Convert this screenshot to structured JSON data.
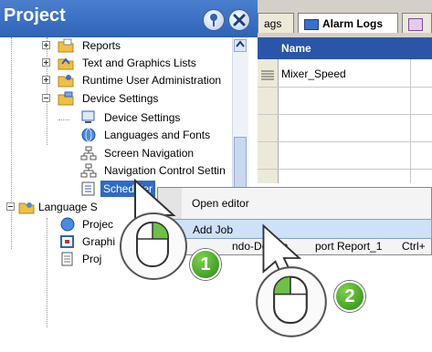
{
  "project_panel": {
    "title": "Project",
    "tree": [
      {
        "label": "Reports",
        "expander": "plus"
      },
      {
        "label": "Text and Graphics Lists",
        "expander": "plus"
      },
      {
        "label": "Runtime User Administration",
        "expander": "plus"
      },
      {
        "label": "Device Settings",
        "expander": "minus"
      },
      {
        "label": "Device Settings"
      },
      {
        "label": "Languages and Fonts"
      },
      {
        "label": "Screen Navigation"
      },
      {
        "label": "Navigation Control Settin"
      },
      {
        "label": "Scheduler",
        "selected": true
      },
      {
        "label": "Language Settings",
        "visible_label": "Language S",
        "expander": "minus"
      },
      {
        "label": "Project",
        "visible_label": "Projec"
      },
      {
        "label": "Graphics",
        "visible_label": "Graphi"
      },
      {
        "label": "Project",
        "visible_label": "Proj"
      }
    ]
  },
  "editor": {
    "tabs": [
      "ags",
      "Alarm Logs"
    ],
    "grid_header": "Name",
    "rows": [
      "Mixer_Speed"
    ]
  },
  "context_menu": {
    "items": [
      {
        "label": "Open editor"
      },
      {
        "label": "Add Job",
        "highlighted": true
      },
      {
        "label": "ndo-Deletin",
        "extra": "port Report_1",
        "shortcut": "Ctrl+"
      }
    ]
  },
  "callouts": [
    {
      "number": "1"
    },
    {
      "number": "2"
    }
  ],
  "colors": {
    "header_blue": "#2f63b6",
    "selection_blue": "#316ac5",
    "menu_highlight": "#cde1f8",
    "badge_green": "#2a8c14"
  }
}
